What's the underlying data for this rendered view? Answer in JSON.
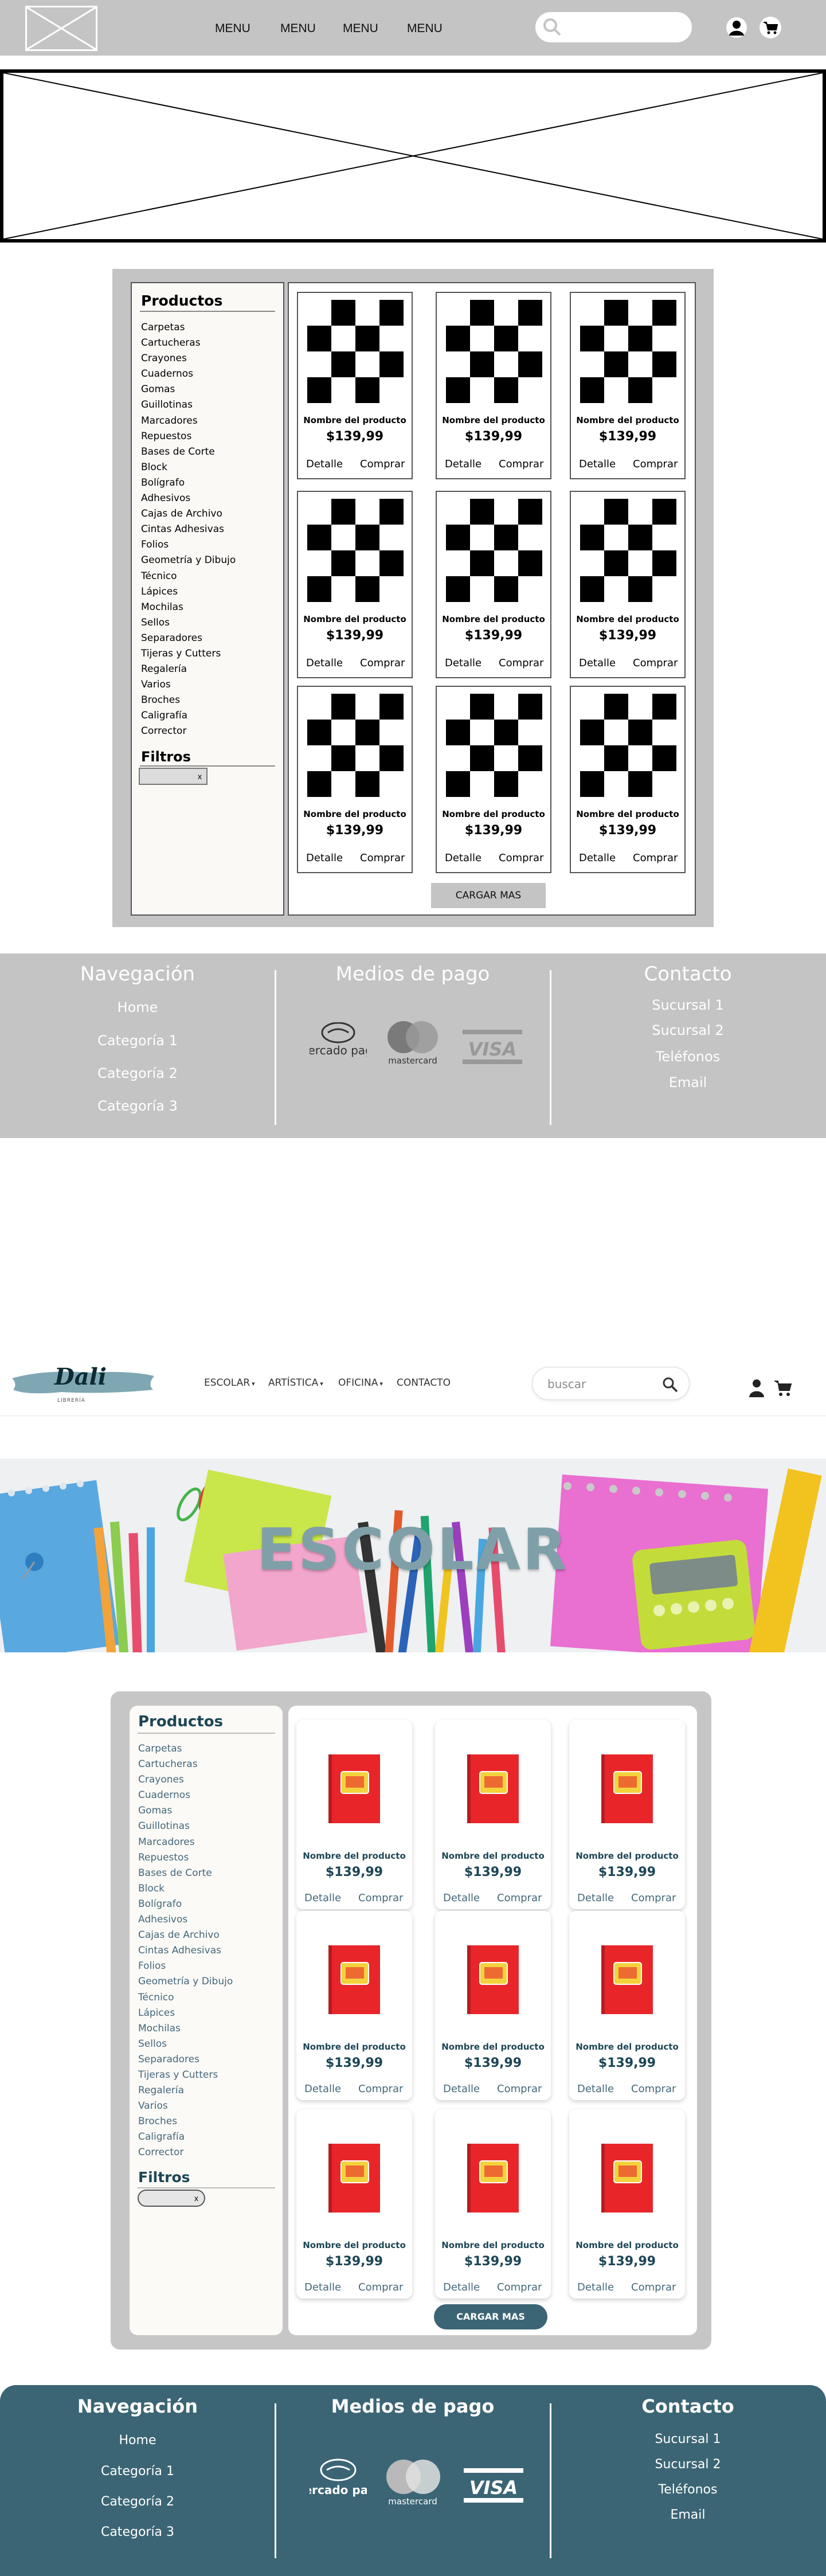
{
  "wireframe": {
    "nav": [
      "MENU",
      "MENU",
      "MENU",
      "MENU"
    ],
    "sidebar": {
      "title": "Productos",
      "categories": [
        "Carpetas",
        "Cartucheras",
        "Crayones",
        "Cuadernos",
        "Gomas",
        "Guillotinas",
        "Marcadores",
        "Repuestos",
        "Bases de Corte",
        "Block",
        "Bolígrafo",
        "Adhesivos",
        "Cajas de Archivo",
        "Cintas Adhesivas",
        "Folios",
        "Geometría y Dibujo",
        "Técnico",
        "Lápices",
        "Mochilas",
        "Sellos",
        "Separadores",
        "Tijeras y Cutters",
        "Regalería",
        "Varios",
        "Broches",
        "Caligrafía",
        "Corrector"
      ],
      "filters_title": "Filtros",
      "filter_chip": "x"
    },
    "products": [
      {
        "name": "Nombre del producto",
        "price": "$139,99",
        "detail": "Detalle",
        "buy": "Comprar"
      },
      {
        "name": "Nombre del producto",
        "price": "$139,99",
        "detail": "Detalle",
        "buy": "Comprar"
      },
      {
        "name": "Nombre del producto",
        "price": "$139,99",
        "detail": "Detalle",
        "buy": "Comprar"
      },
      {
        "name": "Nombre del producto",
        "price": "$139,99",
        "detail": "Detalle",
        "buy": "Comprar"
      },
      {
        "name": "Nombre del producto",
        "price": "$139,99",
        "detail": "Detalle",
        "buy": "Comprar"
      },
      {
        "name": "Nombre del producto",
        "price": "$139,99",
        "detail": "Detalle",
        "buy": "Comprar"
      },
      {
        "name": "Nombre del producto",
        "price": "$139,99",
        "detail": "Detalle",
        "buy": "Comprar"
      },
      {
        "name": "Nombre del producto",
        "price": "$139,99",
        "detail": "Detalle",
        "buy": "Comprar"
      },
      {
        "name": "Nombre del producto",
        "price": "$139,99",
        "detail": "Detalle",
        "buy": "Comprar"
      }
    ],
    "load_more": "CARGAR MAS",
    "footer": {
      "nav_title": "Navegación",
      "nav_items": [
        "Home",
        "Categoría 1",
        "Categoría 2",
        "Categoría 3"
      ],
      "pay_title": "Medios de pago",
      "pay_logos": [
        "mercado pago",
        "mastercard",
        "VISA"
      ],
      "contact_title": "Contacto",
      "contact_items": [
        "Sucursal 1",
        "Sucursal 2",
        "Teléfonos",
        "Email"
      ]
    },
    "colors": {
      "gray": "#c4c4c4",
      "white": "#ffffff",
      "black": "#000000"
    }
  },
  "design": {
    "logo": {
      "text": "Dali",
      "sub": "LIBRERÍA"
    },
    "nav": [
      "ESCOLAR",
      "ARTÍSTICA",
      "OFICINA",
      "CONTACTO"
    ],
    "search_placeholder": "buscar",
    "hero_title": "ESCOLAR",
    "sidebar": {
      "title": "Productos",
      "categories": [
        "Carpetas",
        "Cartucheras",
        "Crayones",
        "Cuadernos",
        "Gomas",
        "Guillotinas",
        "Marcadores",
        "Repuestos",
        "Bases de Corte",
        "Block",
        "Bolígrafo",
        "Adhesivos",
        "Cajas de Archivo",
        "Cintas Adhesivas",
        "Folios",
        "Geometría y Dibujo",
        "Técnico",
        "Lápices",
        "Mochilas",
        "Sellos",
        "Separadores",
        "Tijeras y Cutters",
        "Regalería",
        "Varios",
        "Broches",
        "Caligrafía",
        "Corrector"
      ],
      "filters_title": "Filtros",
      "filter_chip": "x"
    },
    "products": [
      {
        "name": "Nombre del producto",
        "price": "$139,99",
        "detail": "Detalle",
        "buy": "Comprar"
      },
      {
        "name": "Nombre del producto",
        "price": "$139,99",
        "detail": "Detalle",
        "buy": "Comprar"
      },
      {
        "name": "Nombre del producto",
        "price": "$139,99",
        "detail": "Detalle",
        "buy": "Comprar"
      },
      {
        "name": "Nombre del producto",
        "price": "$139,99",
        "detail": "Detalle",
        "buy": "Comprar"
      },
      {
        "name": "Nombre del producto",
        "price": "$139,99",
        "detail": "Detalle",
        "buy": "Comprar"
      },
      {
        "name": "Nombre del producto",
        "price": "$139,99",
        "detail": "Detalle",
        "buy": "Comprar"
      },
      {
        "name": "Nombre del producto",
        "price": "$139,99",
        "detail": "Detalle",
        "buy": "Comprar"
      },
      {
        "name": "Nombre del producto",
        "price": "$139,99",
        "detail": "Detalle",
        "buy": "Comprar"
      },
      {
        "name": "Nombre del producto",
        "price": "$139,99",
        "detail": "Detalle",
        "buy": "Comprar"
      }
    ],
    "load_more": "CARGAR MAS",
    "footer": {
      "nav_title": "Navegación",
      "nav_items": [
        "Home",
        "Categoría 1",
        "Categoría 2",
        "Categoría 3"
      ],
      "pay_title": "Medios de pago",
      "pay_logos": [
        "mercado pago",
        "mastercard",
        "VISA"
      ],
      "contact_title": "Contacto",
      "contact_items": [
        "Sucursal 1",
        "Sucursal 2",
        "Teléfonos",
        "Email"
      ]
    },
    "colors": {
      "brand": "#3b6574",
      "heading": "#1d4656",
      "text": "#44677a",
      "panel": "#c6c6c6"
    }
  }
}
